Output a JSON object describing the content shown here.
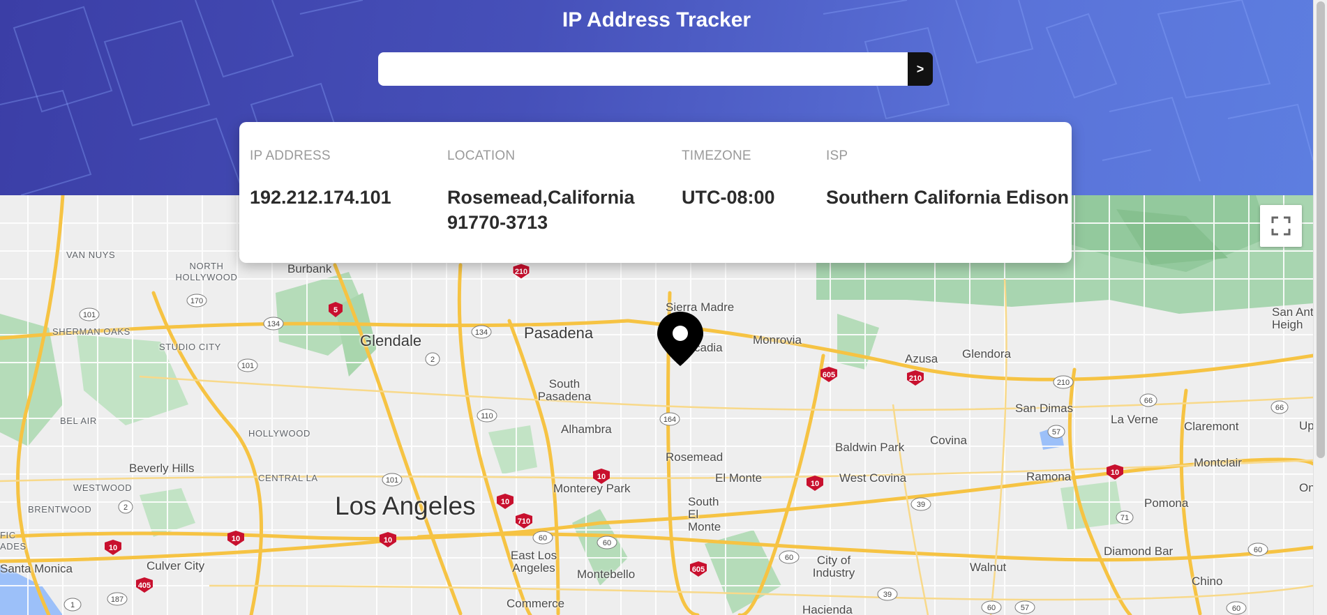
{
  "header": {
    "title": "IP Address Tracker",
    "search_placeholder": "",
    "search_button_label": ">"
  },
  "info": {
    "ip_label": "IP ADDRESS",
    "ip_value": "192.212.174.101",
    "location_label": "LOCATION",
    "location_value": "Rosemead,California 91770-3713",
    "timezone_label": "TIMEZONE",
    "timezone_value": "UTC-08:00",
    "isp_label": "ISP",
    "isp_value": "Southern California Edison"
  },
  "map": {
    "cities": {
      "los_angeles": "Los Angeles",
      "glendale": "Glendale",
      "pasadena": "Pasadena",
      "burbank": "Burbank",
      "sierra_madre": "Sierra Madre",
      "arcadia": "Arcadia",
      "monrovia": "Monrovia",
      "azusa": "Azusa",
      "glendora": "Glendora",
      "san_antonio_heights": "San Ant Heigh",
      "south_pasadena": "South Pasadena",
      "alhambra": "Alhambra",
      "rosemead": "Rosemead",
      "el_monte": "El Monte",
      "south_el_monte": "South El Monte",
      "baldwin_park": "Baldwin Park",
      "covina": "Covina",
      "west_covina": "West Covina",
      "san_dimas": "San Dimas",
      "la_verne": "La Verne",
      "claremont": "Claremont",
      "upland": "Up",
      "montclair": "Montclair",
      "ontario": "Ont",
      "pomona": "Pomona",
      "ramona": "Ramona",
      "diamond_bar": "Diamond Bar",
      "chino": "Chino",
      "walnut": "Walnut",
      "city_of_industry": "City of Industry",
      "hacienda": "Hacienda",
      "monterey_park": "Monterey Park",
      "east_los_angeles": "East Los Angeles",
      "montebello": "Montebello",
      "commerce": "Commerce",
      "beverly_hills": "Beverly Hills",
      "culver_city": "Culver City",
      "santa_monica": "Santa Monica"
    },
    "districts": {
      "van_nuys": "VAN NUYS",
      "north_hollywood": "NORTH HOLLYWOOD",
      "sherman_oaks": "SHERMAN OAKS",
      "studio_city": "STUDIO CITY",
      "bel_air": "BEL AIR",
      "hollywood": "HOLLYWOOD",
      "central_la": "CENTRAL LA",
      "westwood": "WESTWOOD",
      "brentwood": "BRENTWOOD",
      "pacific_palisades": "FIC ADES"
    },
    "highway_shields": [
      "101",
      "170",
      "134",
      "5",
      "210",
      "2",
      "110",
      "164",
      "605",
      "10",
      "710",
      "60",
      "405",
      "187",
      "1",
      "66",
      "57",
      "71",
      "39"
    ],
    "marker_icon": "location-pin-icon",
    "fullscreen_icon": "fullscreen-icon"
  }
}
